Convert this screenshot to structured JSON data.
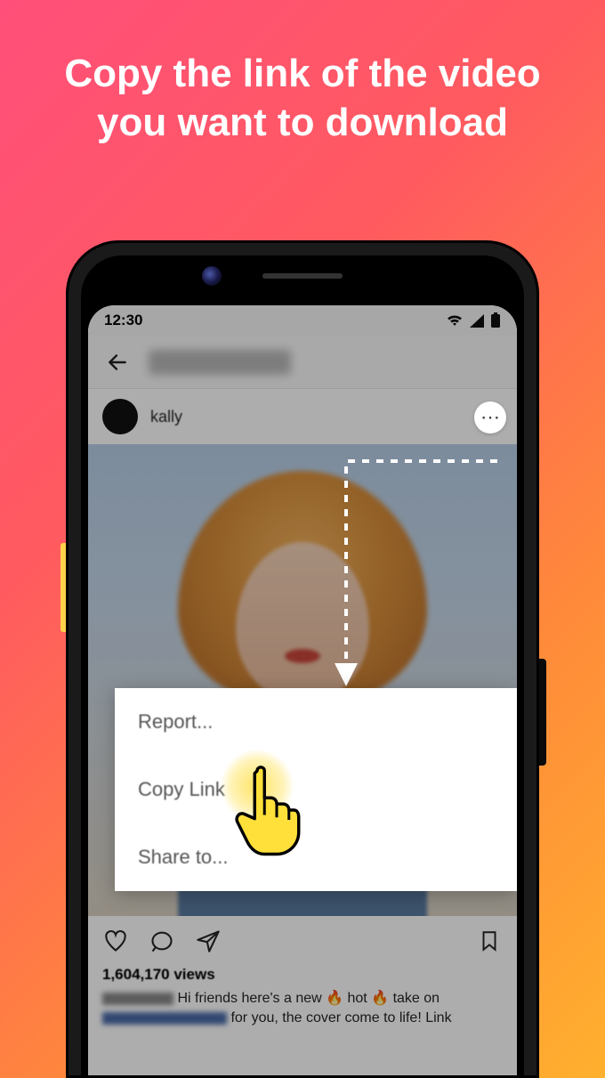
{
  "headline": "Copy the link of the video you want to download",
  "statusbar": {
    "time": "12:30"
  },
  "post": {
    "username": "kally",
    "views_label": "1,604,170 views",
    "caption_fragment_1": " Hi friends here's a new ",
    "caption_emoji": "🔥",
    "caption_fragment_2": " hot ",
    "caption_fragment_3": " take on ",
    "caption_fragment_4": " for you, the cover come to life! Link"
  },
  "menu": {
    "report": "Report...",
    "copy_link": "Copy Link",
    "share_to": "Share to..."
  }
}
